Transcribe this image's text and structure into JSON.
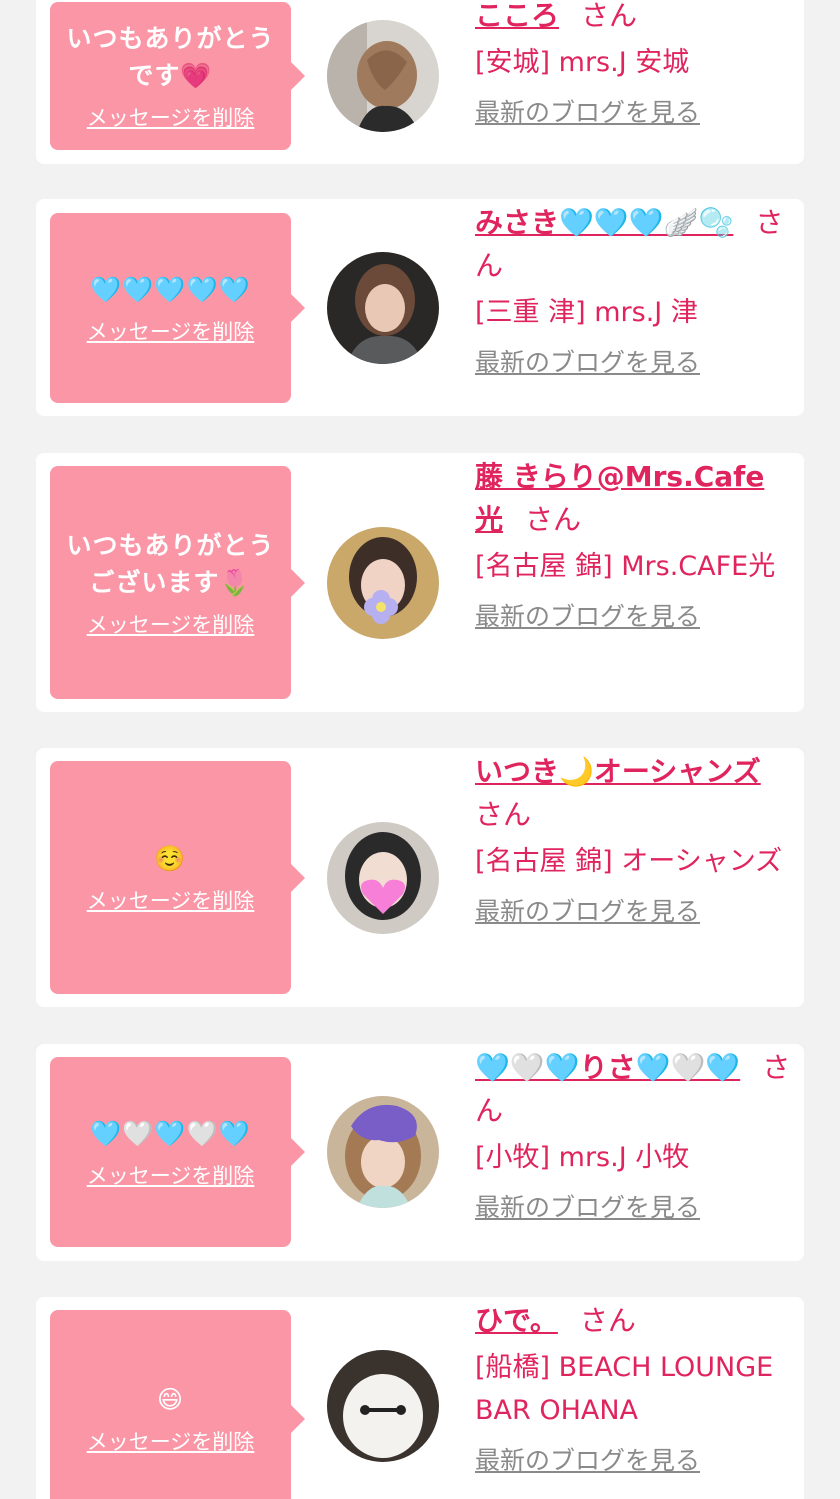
{
  "delete_label": "メッセージを削除",
  "blog_label": "最新のブログを見る",
  "san_label": "さん",
  "colors": {
    "background": "#f2f2f2",
    "card": "#ffffff",
    "bubble": "#fb96a6",
    "name": "#e0245e",
    "link_gray": "#8a8a8a"
  },
  "messages": [
    {
      "message": "いつもありがとうです💗",
      "name": "こころ",
      "shop": "[安城] mrs.J 安城",
      "avatar_icon": "avatar-photo-hair-icon"
    },
    {
      "message": "🩵🩵🩵🩵🩵",
      "name": "みさき🩵🩵🩵🪽🫧",
      "shop": "[三重 津] mrs.J 津",
      "avatar_icon": "avatar-photo-woman-icon"
    },
    {
      "message": "いつもありがとうございます🌷",
      "name": "藤 きらり@Mrs.Cafe光",
      "shop": "[名古屋 錦] Mrs.CAFE光",
      "avatar_icon": "avatar-photo-flower-icon"
    },
    {
      "message": "☺️",
      "name": "いつき🌙オーシャンズ",
      "shop": "[名古屋 錦] オーシャンズ",
      "avatar_icon": "avatar-photo-heart-icon"
    },
    {
      "message": "🩵🤍🩵🤍🩵",
      "name": "🩵🤍🩵りさ🩵🤍🩵",
      "shop": "[小牧] mrs.J 小牧",
      "avatar_icon": "avatar-photo-purple-icon"
    },
    {
      "message": "😄",
      "name": "ひで。",
      "shop": "[船橋] BEACH LOUNGE BAR OHANA",
      "avatar_icon": "avatar-photo-mascot-icon"
    }
  ]
}
